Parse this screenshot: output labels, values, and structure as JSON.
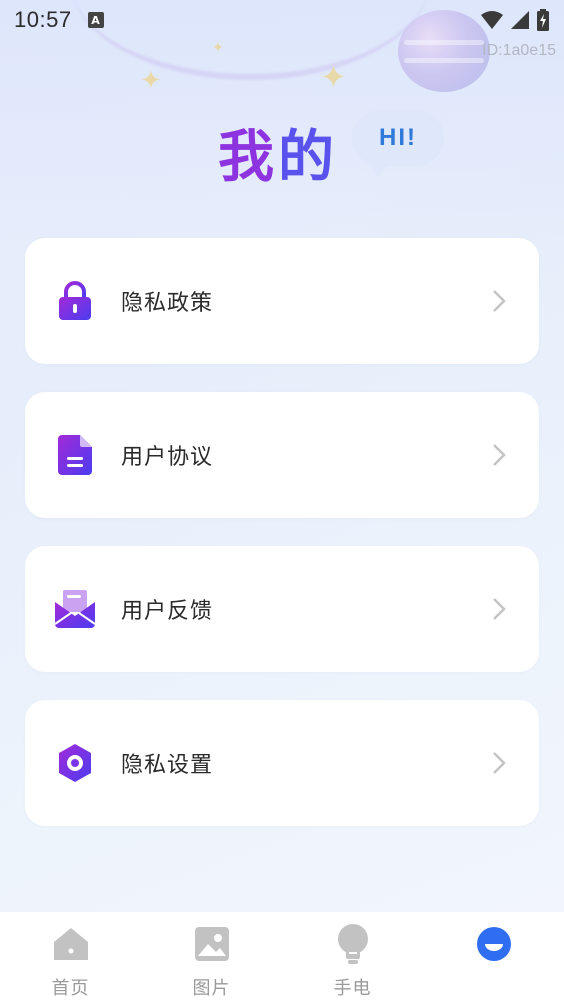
{
  "status_bar": {
    "time": "10:57",
    "notification_icon": "A",
    "icons": [
      "wifi-icon",
      "cell-signal-icon",
      "battery-icon"
    ]
  },
  "device_id": "ID:1a0e15",
  "header": {
    "title_chars": [
      "我",
      "的"
    ],
    "greeting": "HI!"
  },
  "menu": {
    "items": [
      {
        "label": "隐私政策",
        "icon": "lock-icon"
      },
      {
        "label": "用户协议",
        "icon": "document-icon"
      },
      {
        "label": "用户反馈",
        "icon": "mail-icon"
      },
      {
        "label": "隐私设置",
        "icon": "gear-icon"
      }
    ]
  },
  "tabbar": {
    "items": [
      {
        "label": "首页",
        "icon": "home-icon",
        "active": false
      },
      {
        "label": "图片",
        "icon": "image-icon",
        "active": false
      },
      {
        "label": "手电",
        "icon": "bulb-icon",
        "active": false
      },
      {
        "label": "",
        "icon": "profile-icon",
        "active": true
      }
    ]
  },
  "colors": {
    "accent_purple": "#8a2be2",
    "accent_blue": "#2f6ef0",
    "tab_inactive": "#bdbdbd",
    "tab_active": "#2f6ef0"
  }
}
